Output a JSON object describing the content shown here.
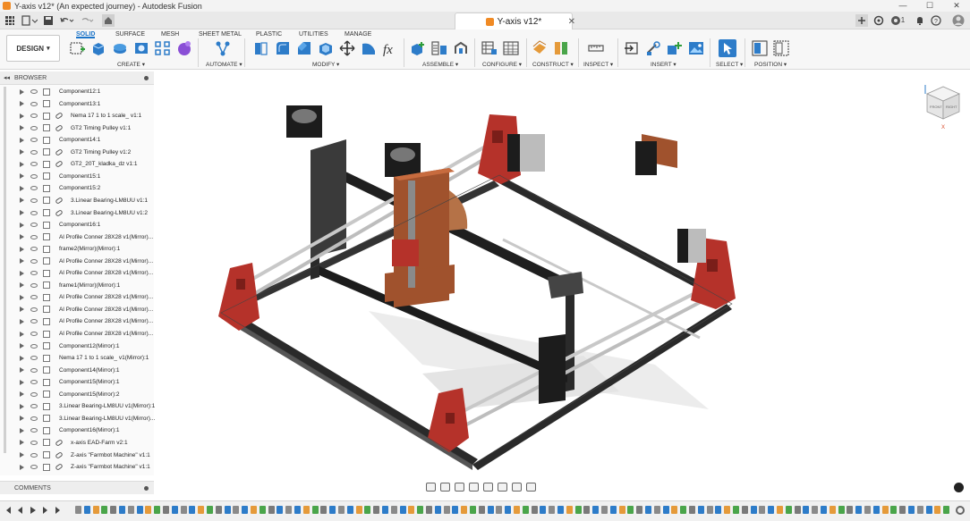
{
  "window": {
    "title": "Y-axis v12* (An expected journey) - Autodesk Fusion",
    "controls": [
      "—",
      "☐",
      "✕"
    ]
  },
  "document_tab": {
    "label": "Y-axis v12*",
    "close": "✕"
  },
  "quick_access": {
    "grid_icon": "grid-icon",
    "file_icon": "file-icon",
    "save_icon": "save-icon",
    "undo_icon": "undo-icon",
    "redo_icon": "redo-icon",
    "home_icon": "home-icon",
    "right_icons": [
      "plus-icon",
      "extensions-icon",
      "job-status-icon",
      "notifications-icon",
      "help-icon",
      "user-avatar"
    ],
    "job_count": "1"
  },
  "workspace_button": "DESIGN",
  "ribbon_tabs": [
    {
      "label": "SOLID",
      "active": true
    },
    {
      "label": "SURFACE",
      "active": false
    },
    {
      "label": "MESH",
      "active": false
    },
    {
      "label": "SHEET METAL",
      "active": false
    },
    {
      "label": "PLASTIC",
      "active": false
    },
    {
      "label": "UTILITIES",
      "active": false
    },
    {
      "label": "MANAGE",
      "active": false
    }
  ],
  "ribbon_groups": [
    {
      "label": "CREATE ▾"
    },
    {
      "label": "AUTOMATE ▾"
    },
    {
      "label": "MODIFY ▾"
    },
    {
      "label": "ASSEMBLE ▾"
    },
    {
      "label": "CONFIGURE ▾"
    },
    {
      "label": "CONSTRUCT ▾"
    },
    {
      "label": "INSPECT ▾"
    },
    {
      "label": "INSERT ▾"
    },
    {
      "label": "SELECT ▾"
    },
    {
      "label": "POSITION ▾"
    }
  ],
  "browser": {
    "title": "BROWSER",
    "items": [
      {
        "label": "Component12:1",
        "linked": false
      },
      {
        "label": "Component13:1",
        "linked": false
      },
      {
        "label": "Nema 17 1 to 1 scale_ v1:1",
        "linked": true
      },
      {
        "label": "GT2 Timing Pulley v1:1",
        "linked": true
      },
      {
        "label": "Component14:1",
        "linked": false
      },
      {
        "label": "GT2 Timing Pulley v1:2",
        "linked": true
      },
      {
        "label": "GT2_20T_kladka_dz v1:1",
        "linked": true
      },
      {
        "label": "Component15:1",
        "linked": false
      },
      {
        "label": "Component15:2",
        "linked": false
      },
      {
        "label": "3.Linear Bearing-LM8UU v1:1",
        "linked": true
      },
      {
        "label": "3.Linear Bearing-LM8UU v1:2",
        "linked": true
      },
      {
        "label": "Component16:1",
        "linked": false
      },
      {
        "label": "Al Profile Conner 28X28 v1(Mirror)...",
        "linked": false
      },
      {
        "label": "frame2(Mirror)(Mirror):1",
        "linked": false
      },
      {
        "label": "Al Profile Conner 28X28 v1(Mirror)...",
        "linked": false
      },
      {
        "label": "Al Profile Conner 28X28 v1(Mirror)...",
        "linked": false
      },
      {
        "label": "frame1(Mirror)(Mirror):1",
        "linked": false
      },
      {
        "label": "Al Profile Conner 28X28 v1(Mirror)...",
        "linked": false
      },
      {
        "label": "Al Profile Conner 28X28 v1(Mirror)...",
        "linked": false
      },
      {
        "label": "Al Profile Conner 28X28 v1(Mirror)...",
        "linked": false
      },
      {
        "label": "Al Profile Conner 28X28 v1(Mirror)...",
        "linked": false
      },
      {
        "label": "Component12(Mirror):1",
        "linked": false
      },
      {
        "label": "Nema 17 1 to 1 scale_ v1(Mirror):1",
        "linked": false
      },
      {
        "label": "Component14(Mirror):1",
        "linked": false
      },
      {
        "label": "Component15(Mirror):1",
        "linked": false
      },
      {
        "label": "Component15(Mirror):2",
        "linked": false
      },
      {
        "label": "3.Linear Bearing-LM8UU v1(Mirror):1",
        "linked": false
      },
      {
        "label": "3.Linear Bearing-LM8UU v1(Mirror)...",
        "linked": false
      },
      {
        "label": "Component16(Mirror):1",
        "linked": false
      },
      {
        "label": "x-axis EAD-Farm v2:1",
        "linked": true
      },
      {
        "label": "Z-axis \"Farmbot Machine\" v1:1",
        "linked": true
      },
      {
        "label": "Z-axis \"Farmbot Machine\" v1:1",
        "linked": true
      }
    ]
  },
  "comments": {
    "title": "COMMENTS"
  },
  "viewcube": {
    "faces": [
      "FRONT",
      "RIGHT",
      "TOP"
    ],
    "axes": [
      "Z",
      "X"
    ]
  },
  "colors": {
    "accent": "#1a73c8",
    "bracket_red": "#b5322a",
    "wood": "#a0522d",
    "frame": "#2a2a2a"
  }
}
